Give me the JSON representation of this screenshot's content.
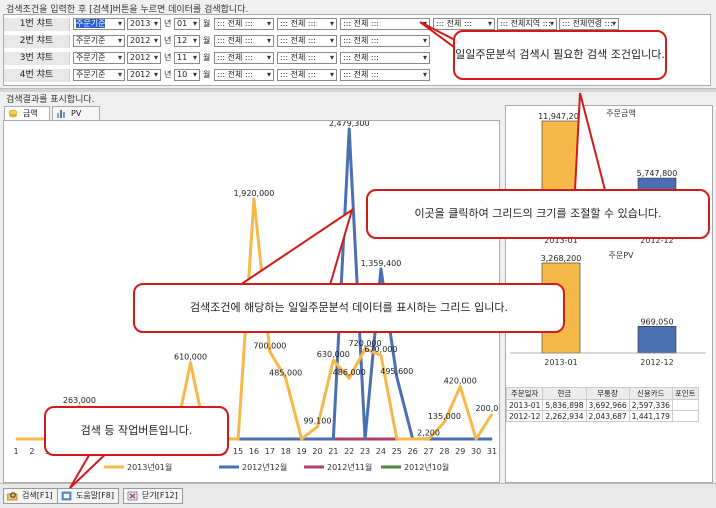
{
  "condition_panel": {
    "title": "검색조건을 입력한 후 [검색]버튼을 누르면 데이터를 검색합니다.",
    "year_unit": "년",
    "month_unit": "월",
    "rows": [
      {
        "label": "1번 챠트",
        "basis": "주문기준",
        "year": "2013",
        "month": "01",
        "f1": "::: 전체 :::",
        "f2": "::: 전체 :::",
        "f3": "::: 전체 :::",
        "f4": "::: 전체 :::",
        "f5": "::: 전체지역 :::",
        "f6": "::: 전체연령 :::"
      },
      {
        "label": "2번 챠트",
        "basis": "주문기준",
        "year": "2012",
        "month": "12",
        "f1": "::: 전체 :::",
        "f2": "::: 전체 :::",
        "f3": "::: 전체 :::"
      },
      {
        "label": "3번 챠트",
        "basis": "주문기준",
        "year": "2012",
        "month": "11",
        "f1": "::: 전체 :::",
        "f2": "::: 전체 :::",
        "f3": "::: 전체 :::"
      },
      {
        "label": "4번 챠트",
        "basis": "주문기준",
        "year": "2012",
        "month": "10",
        "f1": "::: 전체 :::",
        "f2": "::: 전체 :::",
        "f3": "::: 전체 :::"
      }
    ]
  },
  "results_panel": {
    "title": "검색결과를 표시합니다.",
    "tabs": [
      "금액",
      "PV"
    ]
  },
  "colors": {
    "s2013_01": "#f7b84a",
    "s2012_12": "#4a6fb3",
    "s2012_11": "#b0406a",
    "s2012_10": "#4a8a3a",
    "callout_border": "#d21a1a"
  },
  "chart_data": [
    {
      "type": "line",
      "title": "",
      "x": [
        1,
        2,
        3,
        4,
        5,
        6,
        7,
        8,
        9,
        10,
        11,
        12,
        13,
        14,
        15,
        16,
        17,
        18,
        19,
        20,
        21,
        22,
        23,
        24,
        25,
        26,
        27,
        28,
        29,
        30,
        31
      ],
      "xlabel": "",
      "ylabel": "",
      "ylim": [
        0,
        2479300
      ],
      "legend_position": "bottom",
      "visible_data_labels": [
        "2,479,300",
        "1,920,000",
        "1,359,400",
        "700,000",
        "610,000",
        "630,000",
        "720,000",
        "670,000",
        "485,000",
        "495,600",
        "486,000",
        "420,000",
        "263,000",
        "200,000",
        "135,000",
        "99,100",
        "2,200"
      ],
      "series": [
        {
          "name": "2013년01월",
          "values": [
            0,
            0,
            0,
            0,
            263000,
            0,
            0,
            0,
            0,
            0,
            0,
            610000,
            0,
            0,
            0,
            1920000,
            700000,
            485000,
            0,
            99100,
            630000,
            486000,
            720000,
            670000,
            0,
            0,
            0,
            135000,
            420000,
            0,
            200000
          ]
        },
        {
          "name": "2012년12월",
          "values": [
            0,
            0,
            0,
            0,
            0,
            0,
            0,
            0,
            0,
            0,
            0,
            0,
            0,
            0,
            0,
            0,
            0,
            0,
            0,
            0,
            0,
            2479300,
            0,
            1359400,
            495600,
            0,
            2200,
            0,
            0,
            0,
            0
          ]
        },
        {
          "name": "2012년11월",
          "values": [
            0,
            0,
            0,
            0,
            0,
            0,
            0,
            0,
            0,
            0,
            0,
            0,
            0,
            0,
            0,
            0,
            0,
            0,
            0,
            0,
            0,
            0,
            0,
            0,
            0,
            0,
            0,
            0,
            0,
            0,
            0
          ]
        },
        {
          "name": "2012년10월",
          "values": [
            0,
            0,
            0,
            0,
            0,
            0,
            0,
            0,
            0,
            0,
            0,
            0,
            0,
            0,
            0,
            0,
            0,
            0,
            0,
            0,
            0,
            0,
            0,
            0,
            0,
            0,
            0,
            0,
            0,
            0,
            0
          ]
        }
      ]
    },
    {
      "type": "bar",
      "title": "주문금액",
      "categories": [
        "2013-01",
        "2012-12"
      ],
      "values": [
        11947200,
        5747800
      ],
      "value_labels": [
        "11,947,200",
        "5,747,800"
      ]
    },
    {
      "type": "bar",
      "title": "주문PV",
      "categories": [
        "2013-01",
        "2012-12"
      ],
      "values": [
        3268200,
        969050
      ],
      "value_labels": [
        "3,268,200",
        "969,050"
      ]
    },
    {
      "type": "table",
      "columns": [
        "주문일자",
        "현금",
        "무통장",
        "신용카드",
        "포인트"
      ],
      "rows": [
        [
          "2013-01",
          "5,836,898",
          "3,692,966",
          "2,597,336",
          ""
        ],
        [
          "2012-12",
          "2,262,934",
          "2,043,687",
          "1,441,179",
          ""
        ]
      ]
    }
  ],
  "footer": {
    "search": "검색[F1]",
    "help": "도움말[F8]",
    "close": "닫기[F12]"
  },
  "callouts": {
    "condition": "일일주문분석 검색시 필요한 검색 조건입니다.",
    "resize": "이곳을 클릭하여 그리드의 크기를 조절할 수 있습니다.",
    "grid": "검색조건에 해당하는 일일주문분석 데이터를 표시하는 그리드 입니다.",
    "buttons": "검색 등 작업버튼입니다."
  }
}
